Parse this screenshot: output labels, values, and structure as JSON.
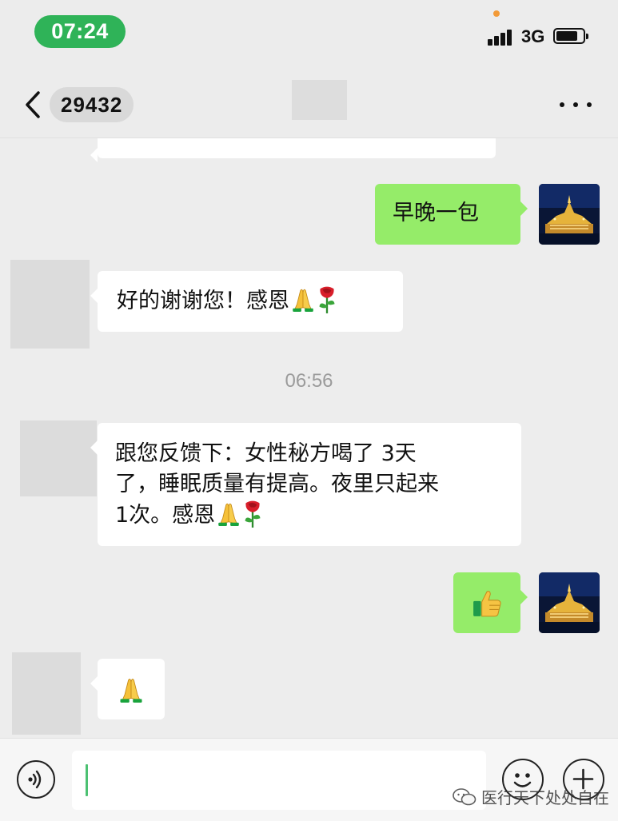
{
  "status_bar": {
    "time": "07:24",
    "network": "3G"
  },
  "nav": {
    "title": "29432"
  },
  "messages": [
    {
      "id": "m1",
      "side": "right",
      "text": "早晚一包"
    },
    {
      "id": "m2",
      "side": "left",
      "text": "好的谢谢您！感恩"
    },
    {
      "id": "ts",
      "type": "timestamp",
      "text": "06:56"
    },
    {
      "id": "m3",
      "side": "left",
      "line1": "跟您反馈下：女性秘方喝了 3天",
      "line2": "了，睡眠质量有提高。夜里只起来",
      "line3": "1次。感恩"
    },
    {
      "id": "m4",
      "side": "right",
      "emoji": "thumbs-up"
    },
    {
      "id": "m5",
      "side": "left",
      "emoji": "folded-hands"
    }
  ],
  "watermark": {
    "text": "医行天下处处自在"
  },
  "colors": {
    "bubble_out": "#95ec69",
    "bubble_in": "#ffffff",
    "background": "#ededed",
    "time_pill": "#2fb358",
    "cursor": "#4cc172"
  }
}
